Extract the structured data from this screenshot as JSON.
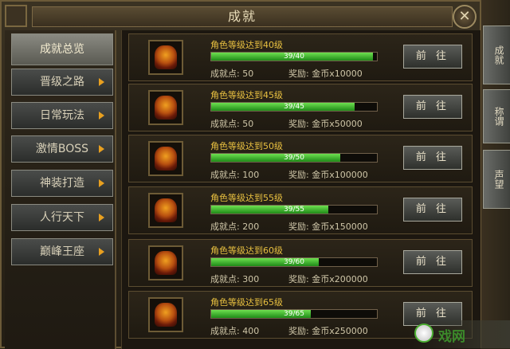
{
  "window": {
    "title": "成就"
  },
  "sidebar": {
    "items": [
      {
        "label": "成就总览",
        "active": true
      },
      {
        "label": "晋级之路"
      },
      {
        "label": "日常玩法"
      },
      {
        "label": "激情BOSS"
      },
      {
        "label": "神装打造"
      },
      {
        "label": "人行天下"
      },
      {
        "label": "巅峰王座"
      }
    ]
  },
  "achievements": [
    {
      "title": "角色等级达到40级",
      "progress_text": "39/40",
      "progress": 0.975,
      "points": "成就点: 50",
      "reward": "奖励: 金币x10000",
      "button": "前 往"
    },
    {
      "title": "角色等级达到45级",
      "progress_text": "39/45",
      "progress": 0.867,
      "points": "成就点: 50",
      "reward": "奖励: 金币x50000",
      "button": "前 往"
    },
    {
      "title": "角色等级达到50级",
      "progress_text": "39/50",
      "progress": 0.78,
      "points": "成就点: 100",
      "reward": "奖励: 金币x100000",
      "button": "前 往"
    },
    {
      "title": "角色等级达到55级",
      "progress_text": "39/55",
      "progress": 0.709,
      "points": "成就点: 200",
      "reward": "奖励: 金币x150000",
      "button": "前 往"
    },
    {
      "title": "角色等级达到60级",
      "progress_text": "39/60",
      "progress": 0.65,
      "points": "成就点: 300",
      "reward": "奖励: 金币x200000",
      "button": "前 往"
    },
    {
      "title": "角色等级达到65级",
      "progress_text": "39/65",
      "progress": 0.6,
      "points": "成就点: 400",
      "reward": "奖励: 金币x250000",
      "button": "前 往"
    }
  ],
  "right_tabs": [
    "成就",
    "称谓",
    "声望"
  ],
  "watermark": {
    "text": "戏网"
  },
  "colors": {
    "progress_green": "#3fbf2a",
    "title_gold": "#e8c040",
    "arrow_orange": "#e8a020"
  }
}
